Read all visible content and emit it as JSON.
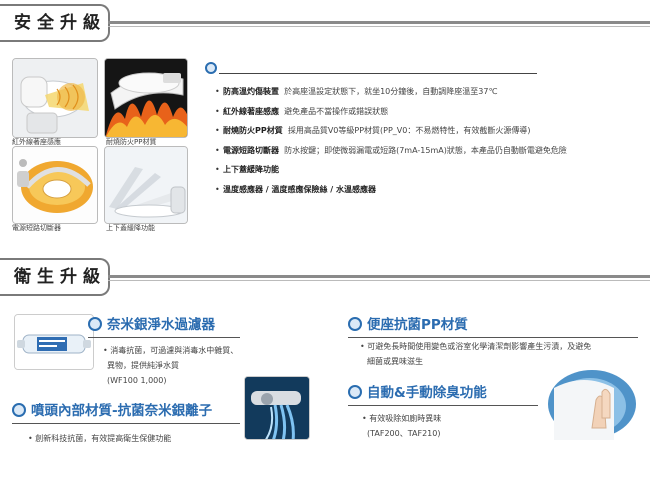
{
  "safety": {
    "title": "安全升級",
    "captions": {
      "infrared": "紅外線著座感應",
      "fireproof": "耐燒防火PP材質",
      "power_cutoff": "電源短路切斷器",
      "lid": "上下蓋緩降功能"
    },
    "features": [
      {
        "key": "防高溫灼傷裝置",
        "value": "於高座溫設定狀態下，就坐10分鐘後，自動調降座溫至37℃"
      },
      {
        "key": "紅外線著座感應",
        "value": "避免產品不當操作或錯誤狀態"
      },
      {
        "key": "耐燒防火PP材質",
        "value": "採用高品質V0等級PP材質(PP_V0：不易燃特性，有效截斷火源傳導)"
      },
      {
        "key": "電源短路切斷器",
        "value": "防水按鍵；即使微弱漏電或短路(7mA-15mA)狀態，本產品仍自動斷電避免危險"
      },
      {
        "key": "上下蓋緩降功能",
        "value": ""
      },
      {
        "key": "溫度感應器 / 溫度感應保險絲 / 水溫感應器",
        "value": ""
      }
    ]
  },
  "hygiene": {
    "title": "衛生升級",
    "filter": {
      "title": "奈米銀淨水過濾器",
      "lines": [
        "消毒抗菌，可過濾與消毒水中雜質、",
        "異物，提供純淨水質",
        "(WF100  1,000)"
      ]
    },
    "nozzle": {
      "title": "噴頭內部材質-抗菌奈米銀離子",
      "lines": [
        "創新科技抗菌，有效提高衛生保健功能"
      ]
    },
    "seat": {
      "title": "便座抗菌PP材質",
      "lines": [
        "可避免長時間使用變色或浴室化學清潔劑影響產生污漬，及避免",
        "細菌或異味滋生"
      ]
    },
    "deodor": {
      "title": "自動&手動除臭功能",
      "lines": [
        "有效吸除如廁時異味",
        "(TAF200、TAF210)"
      ]
    }
  }
}
